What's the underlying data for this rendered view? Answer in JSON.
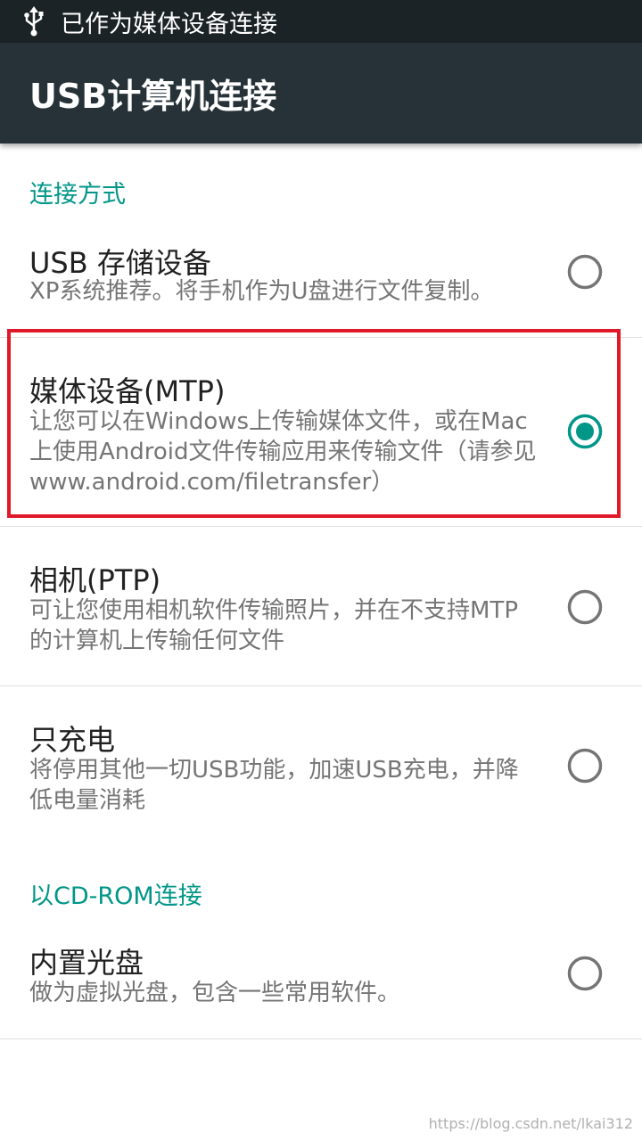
{
  "status_bar": {
    "icon": "usb-icon",
    "text": "已作为媒体设备连接"
  },
  "app_bar": {
    "title": "USB计算机连接"
  },
  "sections": [
    {
      "header": "连接方式",
      "items": [
        {
          "title": "USB 存储设备",
          "summary": "XP系统推荐。将手机作为U盘进行文件复制。",
          "selected": false
        },
        {
          "title": "媒体设备(MTP)",
          "summary": "让您可以在Windows上传输媒体文件，或在Mac上使用Android文件传输应用来传输文件（请参见www.android.com/filetransfer）",
          "selected": true
        },
        {
          "title": "相机(PTP)",
          "summary": "可让您使用相机软件传输照片，并在不支持MTP的计算机上传输任何文件",
          "selected": false
        },
        {
          "title": "只充电",
          "summary": "将停用其他一切USB功能，加速USB充电，并降低电量消耗",
          "selected": false
        }
      ]
    },
    {
      "header": "以CD-ROM连接",
      "items": [
        {
          "title": "内置光盘",
          "summary": "做为虚拟光盘，包含一些常用软件。",
          "selected": false
        }
      ]
    }
  ],
  "watermark": "https://blog.csdn.net/lkai312",
  "colors": {
    "accent": "#009688",
    "status_bar": "#1c2327",
    "app_bar": "#263238",
    "highlight_border": "#e0182a",
    "radio_unchecked": "#757575"
  }
}
